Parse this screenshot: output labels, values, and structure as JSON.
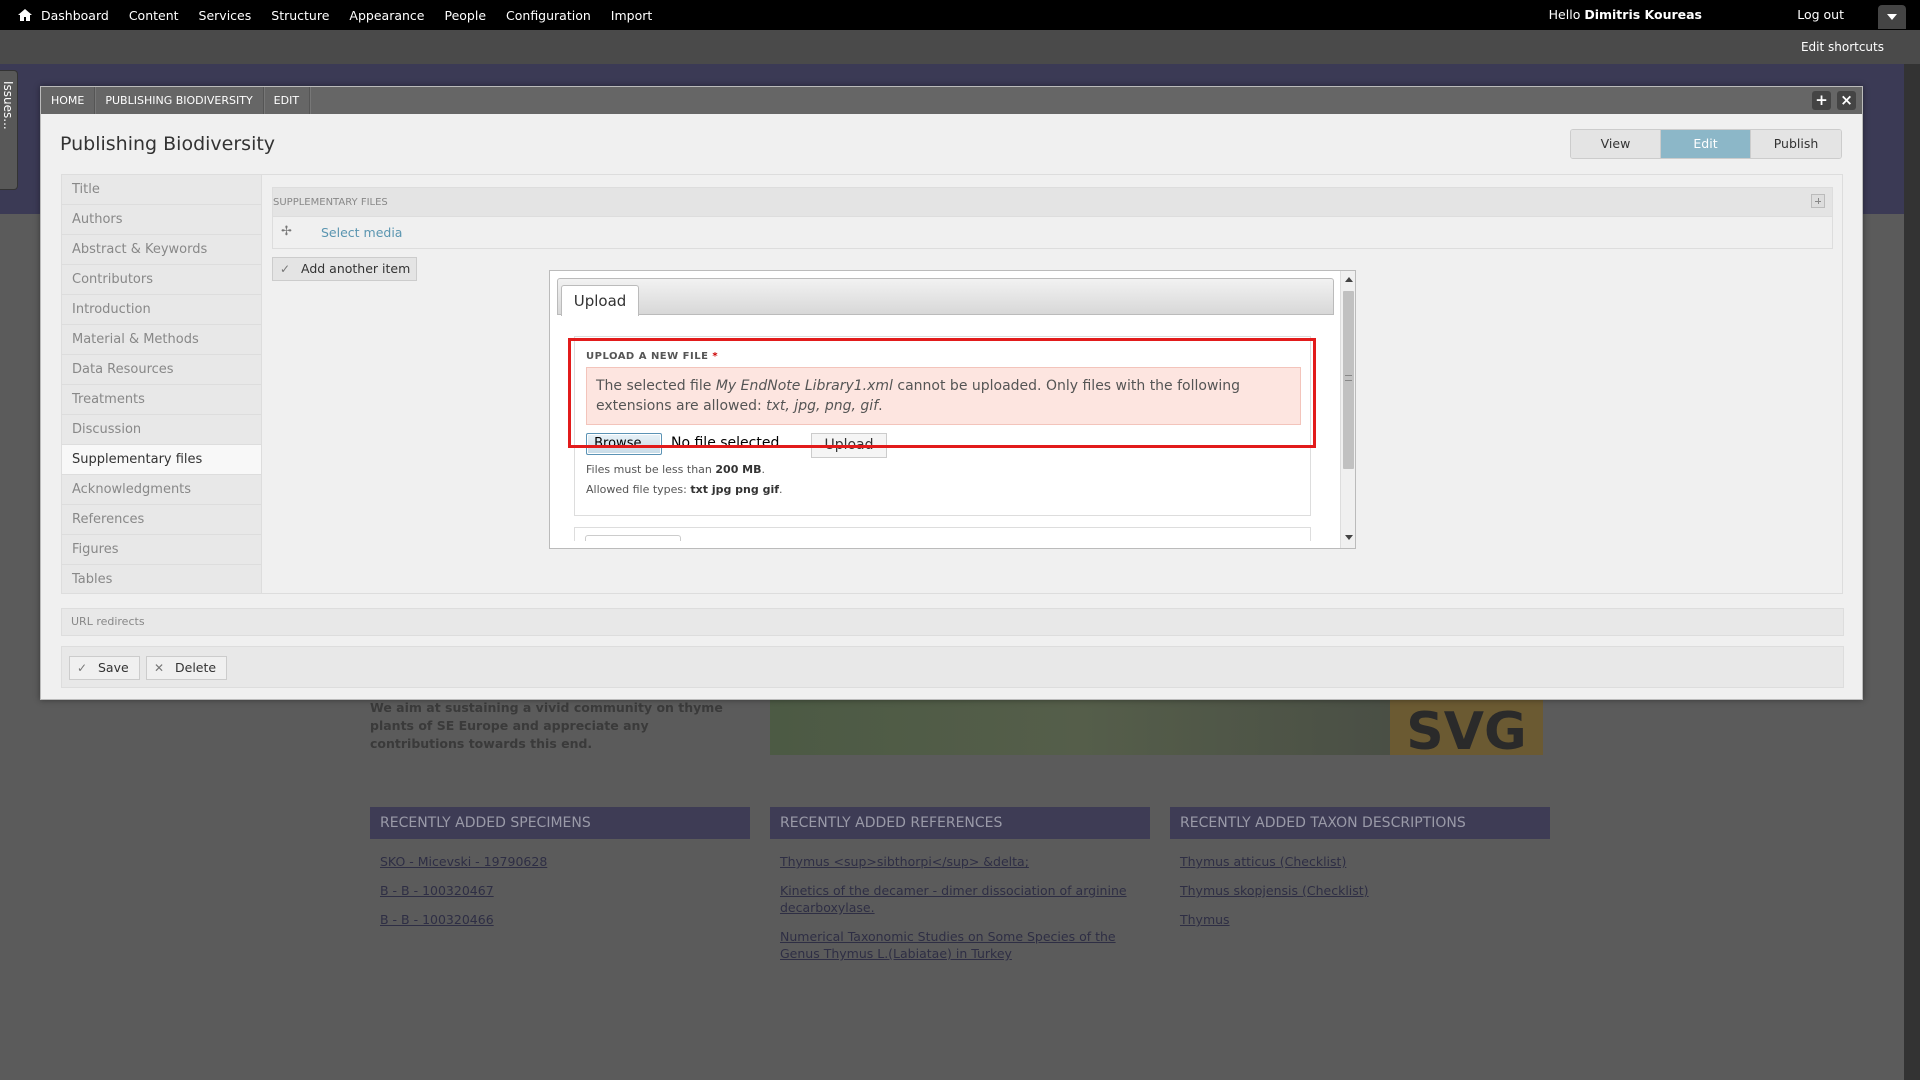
{
  "toolbar": {
    "menu": [
      "Dashboard",
      "Content",
      "Services",
      "Structure",
      "Appearance",
      "People",
      "Configuration",
      "Import"
    ],
    "hello": "Hello",
    "username": "Dimitris Koureas",
    "logout": "Log out",
    "edit_shortcuts": "Edit shortcuts"
  },
  "issues_tab": "Issues...",
  "overlay": {
    "breadcrumbs": [
      "HOME",
      "PUBLISHING BIODIVERSITY",
      "EDIT"
    ],
    "add_icon": "+",
    "close_icon": "×",
    "title": "Publishing Biodiversity",
    "view_tabs": [
      "View",
      "Edit",
      "Publish"
    ],
    "active_view_tab": "Edit",
    "sections": [
      "Title",
      "Authors",
      "Abstract & Keywords",
      "Contributors",
      "Introduction",
      "Material & Methods",
      "Data Resources",
      "Treatments",
      "Discussion",
      "Supplementary files",
      "Acknowledgments",
      "References",
      "Figures",
      "Tables"
    ],
    "active_section": "Supplementary files",
    "supplementary": {
      "header": "SUPPLEMENTARY FILES",
      "select_media": "Select media",
      "add_another": "Add another item"
    },
    "url_redirects": "URL redirects",
    "save": "Save",
    "delete": "Delete"
  },
  "dialog": {
    "tab": "Upload",
    "field_label": "UPLOAD A NEW FILE",
    "required_mark": "*",
    "error_prefix": "The selected file ",
    "error_file": "My EndNote Library1.xml",
    "error_middle": " cannot be uploaded. Only files with the following extensions are allowed: ",
    "error_ext": "txt, jpg, png, gif",
    "error_end": ".",
    "browse": "Browse...",
    "no_file": "No file selected.",
    "upload": "Upload",
    "size_prefix": "Files must be less than ",
    "size_value": "200 MB",
    "size_end": ".",
    "types_prefix": "Allowed file types: ",
    "types_value": "txt jpg png gif",
    "types_end": "."
  },
  "background": {
    "intro": "We aim at sustaining a vivid community on thyme plants of SE Europe and appreciate any contributions towards this end.",
    "logo_text": "SVG",
    "columns": [
      {
        "title": "RECENTLY ADDED SPECIMENS",
        "links": [
          "SKO - Micevski - 19790628",
          "B - B - 100320467",
          "B - B - 100320466"
        ]
      },
      {
        "title": "RECENTLY ADDED REFERENCES",
        "links": [
          "Thymus <sup>sibthorpi</sup> &delta;",
          "Kinetics of the decamer - dimer dissociation of arginine decarboxylase.",
          "Numerical Taxonomic Studies on Some Species of the Genus Thymus L.(Labiatae) in Turkey"
        ]
      },
      {
        "title": "RECENTLY ADDED TAXON DESCRIPTIONS",
        "links": [
          "Thymus atticus (Checklist)",
          "Thymus skopjensis (Checklist)",
          "Thymus"
        ]
      }
    ]
  },
  "colors": {
    "toolbar": "#000000",
    "active_tab": "#8cb7c8",
    "error_bg": "#fde5e0",
    "highlight": "#e21b1b"
  }
}
